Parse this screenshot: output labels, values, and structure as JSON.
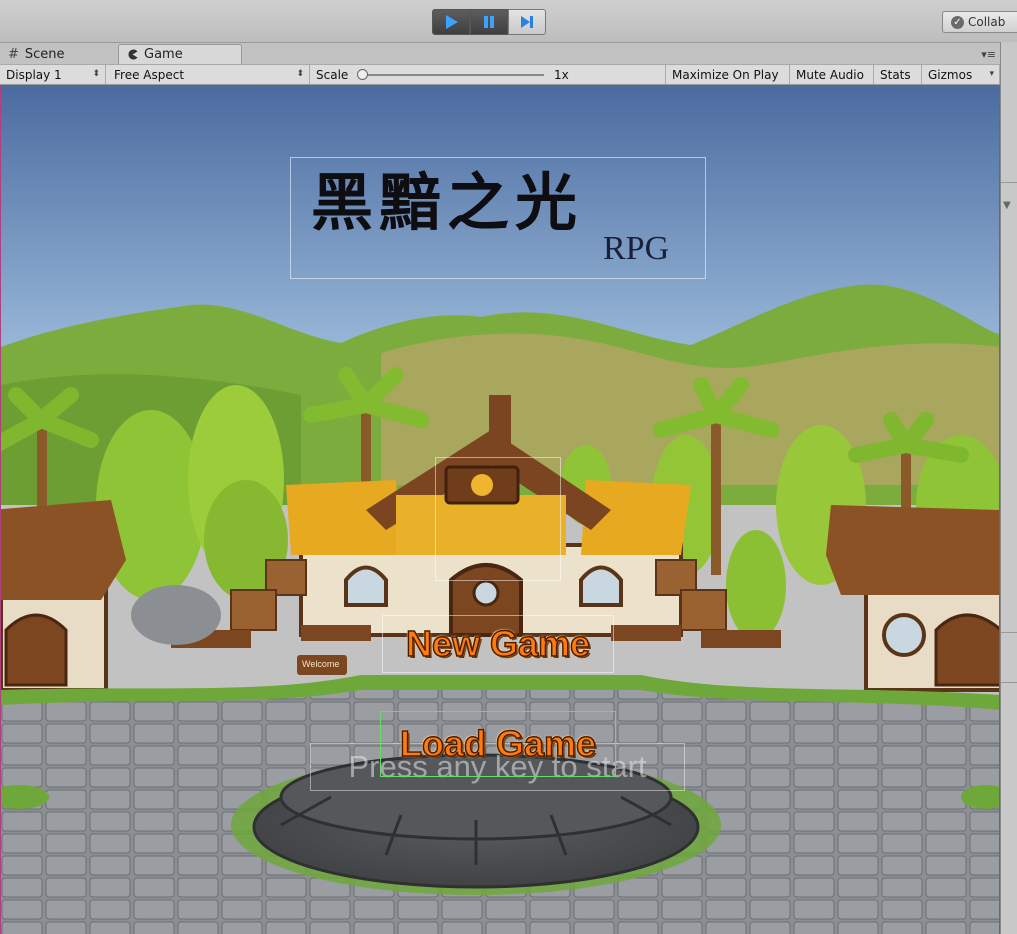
{
  "toolbar": {
    "collab_label": "Collab"
  },
  "tabs": [
    {
      "label": "Scene",
      "icon": "grid-icon"
    },
    {
      "label": "Game",
      "icon": "pacman-icon"
    }
  ],
  "game_toolbar": {
    "display": "Display 1",
    "aspect": "Free Aspect",
    "scale_label": "Scale",
    "scale_value": "1x",
    "maximize": "Maximize On Play",
    "mute": "Mute Audio",
    "stats": "Stats",
    "gizmos": "Gizmos"
  },
  "game": {
    "title": "黑黯之光",
    "title_suffix": "RPG",
    "new_game": "New Game",
    "load_game": "Load Game",
    "press_start": "Press any key to start",
    "sign_text": "Welcome"
  },
  "colors": {
    "sky_top": "#4d6fa3",
    "sky_bottom": "#a9c6e2",
    "grass": "#6fa83a",
    "stone": "#8a8d92",
    "button_text": "#ff7a10",
    "selection": "#66dd66"
  }
}
